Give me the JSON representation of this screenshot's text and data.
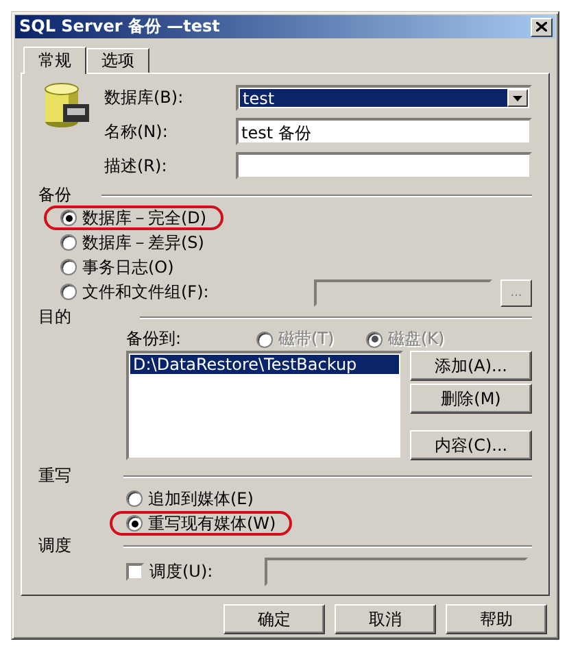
{
  "window": {
    "title": "SQL Server 备份 —test"
  },
  "tabs": [
    {
      "label": "常规",
      "selected": true
    },
    {
      "label": "选项",
      "selected": false
    }
  ],
  "general": {
    "database": {
      "label": "数据库(B):",
      "value": "test"
    },
    "name": {
      "label": "名称(N):",
      "value": "test 备份"
    },
    "description": {
      "label": "描述(R):"
    }
  },
  "backup": {
    "heading": "备份",
    "options": [
      {
        "label": "数据库－完全(D)",
        "selected": true,
        "highlighted": true
      },
      {
        "label": "数据库－差异(S)",
        "selected": false,
        "highlighted": false
      },
      {
        "label": "事务日志(O)",
        "selected": false,
        "highlighted": false
      },
      {
        "label": "文件和文件组(F):",
        "selected": false,
        "highlighted": false
      }
    ],
    "browse_button": "..."
  },
  "destination": {
    "heading": "目的",
    "backup_to_label": "备份到:",
    "media": [
      {
        "label": "磁带(T)",
        "selected": false,
        "disabled": true
      },
      {
        "label": "磁盘(K)",
        "selected": true,
        "disabled": true
      }
    ],
    "list": [
      {
        "text": "D:\\DataRestore\\TestBackup",
        "selected": true
      }
    ],
    "buttons": [
      "添加(A)...",
      "删除(M)",
      "内容(C)..."
    ]
  },
  "overwrite": {
    "heading": "重写",
    "options": [
      {
        "label": "追加到媒体(E)",
        "selected": false,
        "highlighted": false
      },
      {
        "label": "重写现有媒体(W)",
        "selected": true,
        "highlighted": true
      }
    ]
  },
  "schedule": {
    "heading": "调度",
    "checkbox": {
      "label": "调度(U):",
      "checked": false
    }
  },
  "buttons": [
    "确定",
    "取消",
    "帮助"
  ]
}
